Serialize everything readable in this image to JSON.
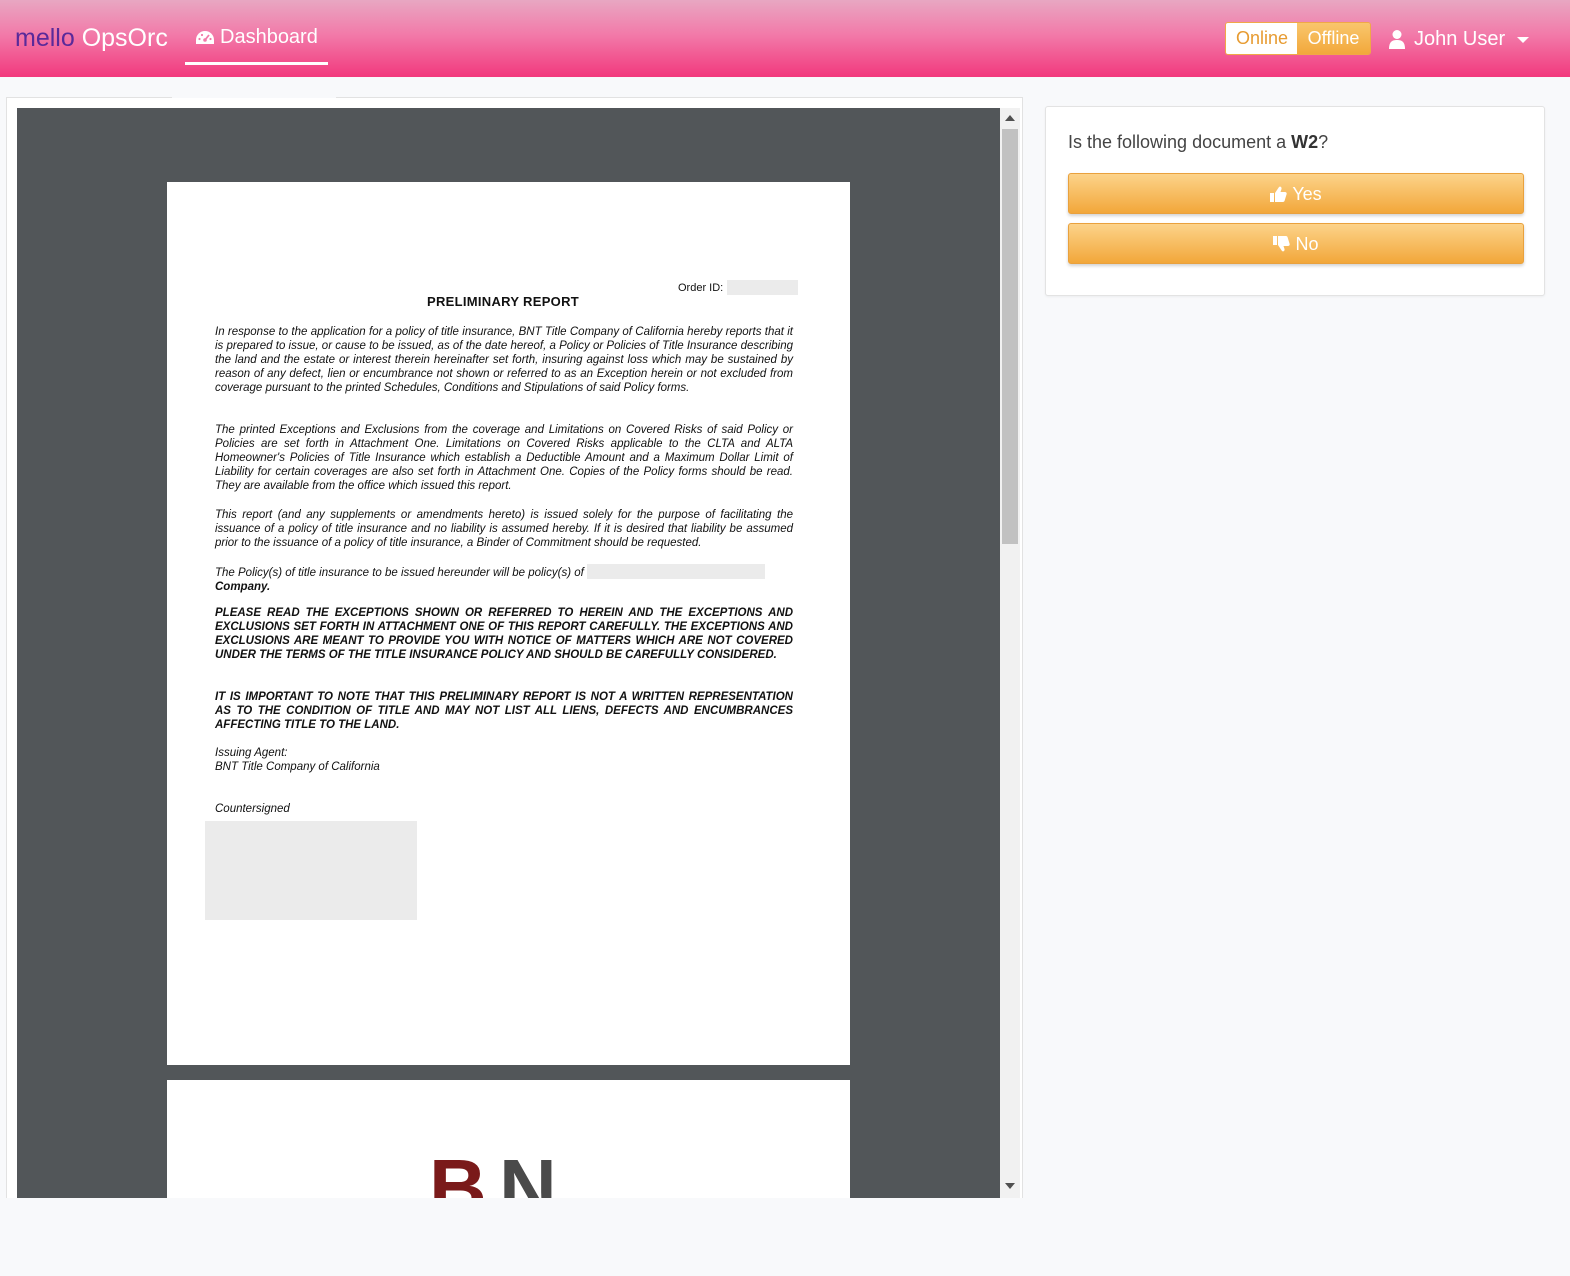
{
  "navbar": {
    "brand_part1": "mello",
    "brand_part2": "OpsOrc",
    "dashboard_label": "Dashboard",
    "status_online": "Online",
    "status_offline": "Offline",
    "user_name": "John User"
  },
  "document": {
    "order_id_label": "Order ID:",
    "title": "PRELIMINARY  REPORT",
    "para1": "In response to the application for a policy of title insurance, BNT Title Company of California hereby reports that it is prepared to issue, or cause to be issued, as of the date hereof, a Policy or Policies of Title Insurance describing the land and the estate or interest therein hereinafter set forth, insuring against loss which may be sustained by reason of any defect, lien or encumbrance not shown or referred to as an Exception herein or not excluded from coverage pursuant to the printed Schedules, Conditions and Stipulations of said Policy forms.",
    "para2": "The printed Exceptions and Exclusions from the coverage and Limitations on Covered Risks of said Policy or Policies are set forth in Attachment One. Limitations on Covered Risks applicable to the CLTA and ALTA Homeowner's Policies of Title Insurance which establish a Deductible Amount and a Maximum Dollar Limit of Liability for certain coverages are also set forth in Attachment One. Copies of the Policy forms should be read. They are available from the office which issued this report.",
    "para3": "This report (and any supplements or amendments hereto) is issued solely for the purpose of facilitating the issuance of a policy of title insurance and no liability is assumed hereby. If it is desired that liability be assumed prior to the issuance of a policy of title insurance, a Binder of Commitment should be requested.",
    "para4_text": "The Policy(s) of title insurance to be issued hereunder will be policy(s) of",
    "para4_company": "Company.",
    "para5": "PLEASE READ THE EXCEPTIONS SHOWN OR REFERRED TO HEREIN AND THE EXCEPTIONS AND EXCLUSIONS SET FORTH IN ATTACHMENT ONE OF THIS REPORT CAREFULLY. THE EXCEPTIONS AND EXCLUSIONS ARE MEANT TO PROVIDE YOU WITH NOTICE OF MATTERS WHICH ARE NOT COVERED UNDER THE TERMS OF THE TITLE INSURANCE POLICY AND SHOULD BE CAREFULLY CONSIDERED.",
    "para6": "IT IS IMPORTANT TO NOTE THAT THIS PRELIMINARY REPORT IS NOT A WRITTEN REPRESENTATION AS TO THE CONDITION OF TITLE AND MAY NOT LIST ALL LIENS, DEFECTS AND ENCUMBRANCES AFFECTING TITLE TO THE LAND.",
    "issuing_agent_label": "Issuing Agent:",
    "issuing_agent_name": "BNT Title Company of California",
    "countersigned": "Countersigned",
    "page2_logo_b": "B",
    "page2_logo_n": "N"
  },
  "question": {
    "prefix": "Is the following document a ",
    "doc_type": "W2",
    "suffix": "?",
    "yes_label": "Yes",
    "no_label": "No"
  },
  "colors": {
    "navbar_top": "#e8a7c2",
    "navbar_bottom": "#f2397d",
    "brand_accent": "#5a2a9a",
    "button_orange": "#f2a73a",
    "viewer_bg": "#525659"
  },
  "icons": [
    "dashboard-icon",
    "user-icon",
    "caret-down-icon",
    "thumbs-up-icon",
    "thumbs-down-icon"
  ]
}
